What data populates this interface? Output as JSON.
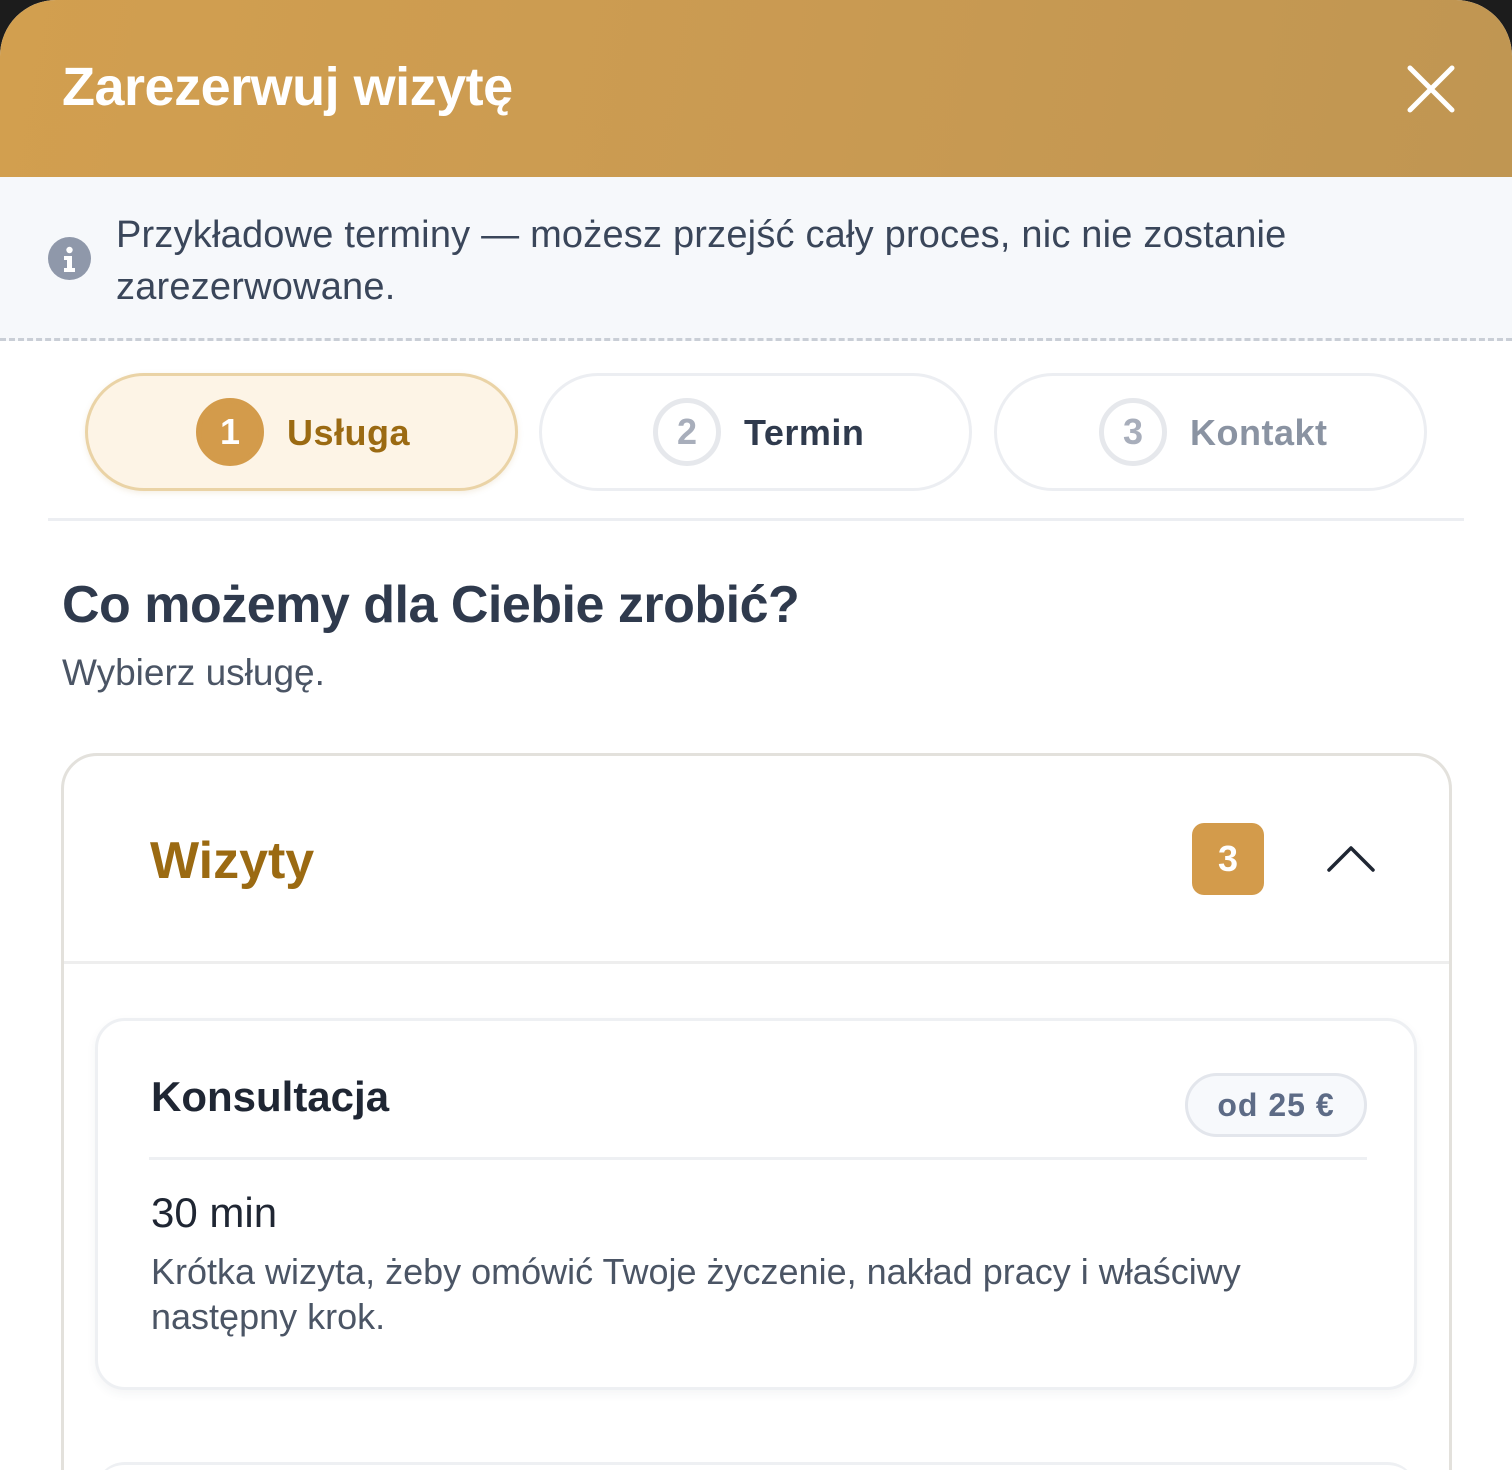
{
  "header": {
    "title": "Zarezerwuj wizytę",
    "close_icon": "close-icon"
  },
  "notice": {
    "icon": "info-icon",
    "text": "Przykładowe terminy — możesz przejść cały proces, nic nie zostanie zarezerwowane."
  },
  "steps": [
    {
      "number": "1",
      "label": "Usługa",
      "state": "active"
    },
    {
      "number": "2",
      "label": "Termin",
      "state": "upcoming"
    },
    {
      "number": "3",
      "label": "Kontakt",
      "state": "upcoming"
    }
  ],
  "main": {
    "title": "Co możemy dla Ciebie zrobić?",
    "subtitle": "Wybierz usługę."
  },
  "category": {
    "title": "Wizyty",
    "count": "3",
    "expanded": true,
    "services": [
      {
        "name": "Konsultacja",
        "price": "od 25 €",
        "duration": "30 min",
        "description": "Krótka wizyta, żeby omówić Twoje życzenie, nakład pracy i właściwy następny krok."
      }
    ]
  },
  "colors": {
    "accent": "#d39b4b",
    "accent_text": "#9b6a12",
    "heading": "#2f3a4d"
  }
}
